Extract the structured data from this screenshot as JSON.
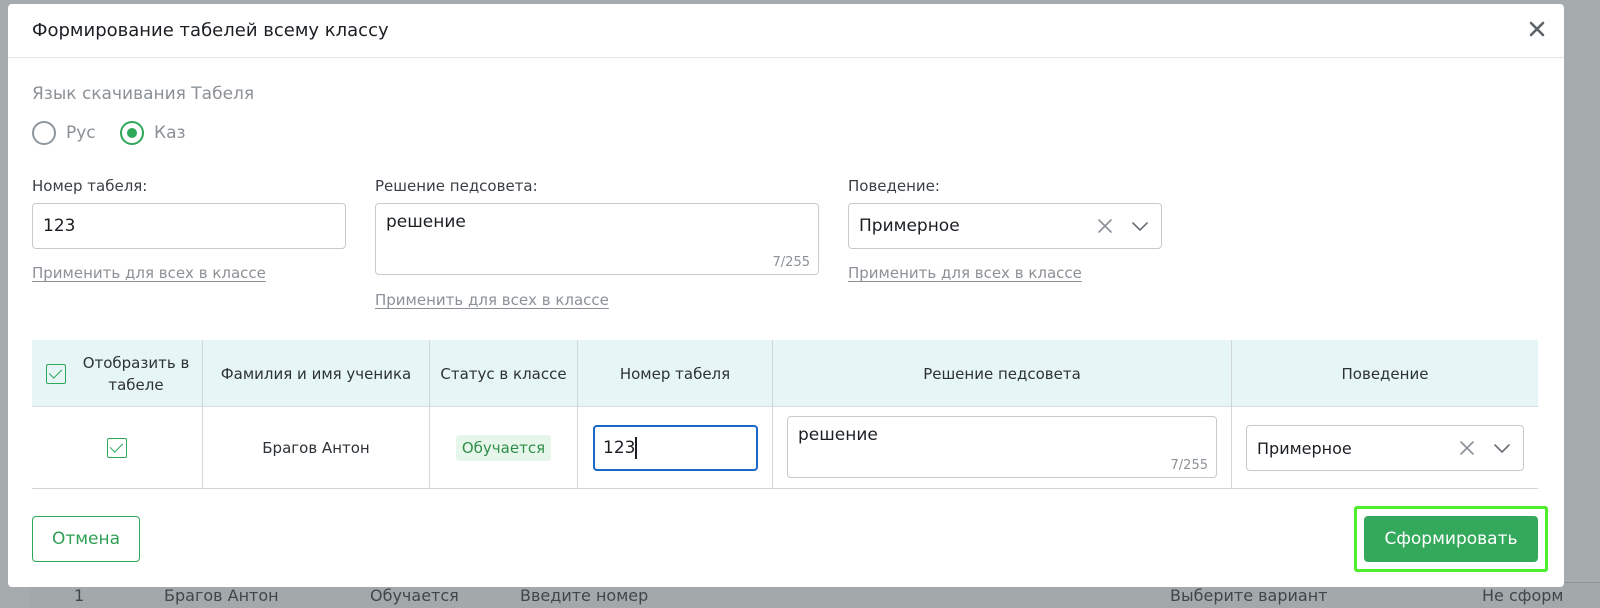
{
  "background": {
    "row": [
      "1",
      "Брагов Антон",
      "Обучается",
      "Введите номер",
      "Выберите вариант",
      "Не сформ"
    ]
  },
  "modal": {
    "title": "Формирование табелей всему классу"
  },
  "language": {
    "label": "Язык скачивания Табеля",
    "options": [
      {
        "label": "Рус",
        "checked": false
      },
      {
        "label": "Каз",
        "checked": true
      }
    ]
  },
  "form": {
    "number": {
      "label": "Номер табеля:",
      "value": "123",
      "apply": "Применить для всех в классе"
    },
    "decision": {
      "label": "Решение педсовета:",
      "value": "решение",
      "counter": "7/255",
      "apply": "Применить для всех в классе"
    },
    "behavior": {
      "label": "Поведение:",
      "value": "Примерное",
      "apply": "Применить для всех в классе"
    }
  },
  "table": {
    "headers": {
      "show": "Отобразить в табеле",
      "name": "Фамилия и имя ученика",
      "status": "Статус в классе",
      "number": "Номер табеля",
      "decision": "Решение педсовета",
      "behavior": "Поведение"
    },
    "rows": [
      {
        "checked": true,
        "name": "Брагов Антон",
        "status": "Обучается",
        "number": "123",
        "decision": "решение",
        "counter": "7/255",
        "behavior": "Примерное"
      }
    ]
  },
  "buttons": {
    "cancel": "Отмена",
    "submit": "Сформировать"
  },
  "colors": {
    "accent": "#35a95b",
    "highlight": "#4dee2a",
    "header_bg": "#e6f5f6"
  }
}
